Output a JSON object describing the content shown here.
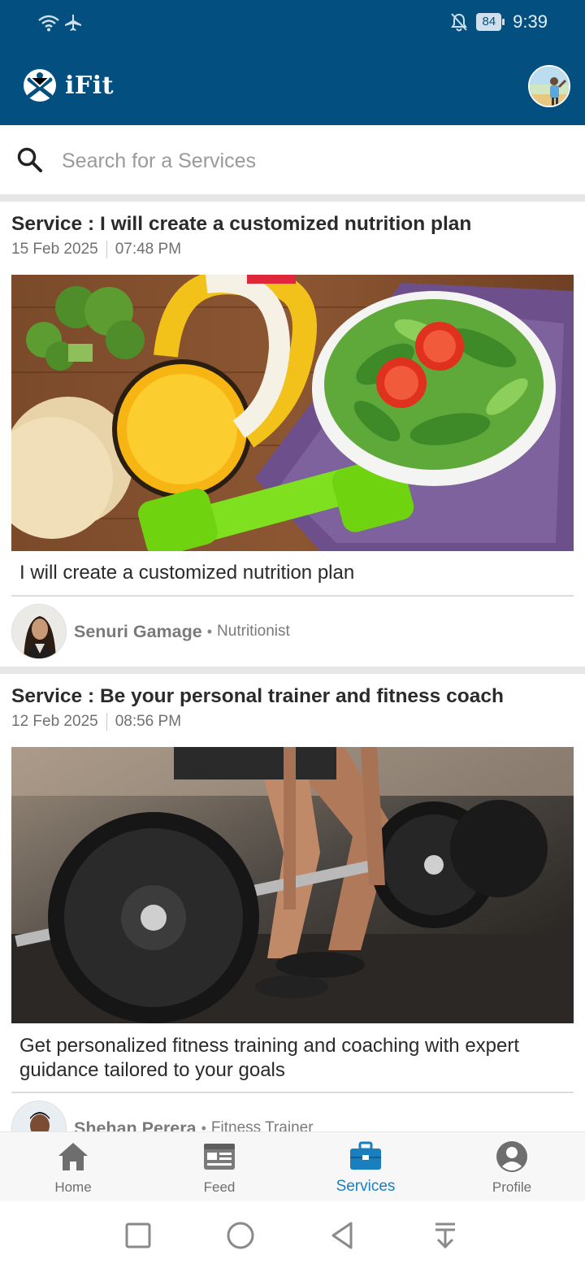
{
  "status_bar": {
    "battery": "84",
    "time": "9:39",
    "icons": [
      "wifi-icon",
      "airplane-icon",
      "bell-off-icon",
      "battery-icon"
    ]
  },
  "app_bar": {
    "title": "iFit",
    "brand_color": "#034f80"
  },
  "search": {
    "placeholder": "Search for a Services"
  },
  "services": [
    {
      "title": "Service : I will create a customized nutrition plan",
      "date": "15 Feb 2025",
      "time": "07:48 PM",
      "description": "I will create a customized nutrition plan",
      "author_name": "Senuri Gamage",
      "author_role": "Nutritionist"
    },
    {
      "title": "Service : Be your personal trainer and fitness coach",
      "date": "12 Feb 2025",
      "time": "08:56 PM",
      "description": "Get personalized fitness training and coaching with expert guidance tailored to your goals",
      "author_name": "Shehan Perera",
      "author_role": "Fitness Trainer"
    }
  ],
  "bottom_nav": {
    "items": [
      {
        "label": "Home",
        "icon": "home-icon"
      },
      {
        "label": "Feed",
        "icon": "feed-icon"
      },
      {
        "label": "Services",
        "icon": "briefcase-icon",
        "active": true
      },
      {
        "label": "Profile",
        "icon": "profile-icon"
      }
    ],
    "active_color": "#1a7fbf"
  },
  "system_nav": {
    "icons": [
      "recents-icon",
      "home-circle-icon",
      "back-icon",
      "notification-pull-icon"
    ]
  }
}
